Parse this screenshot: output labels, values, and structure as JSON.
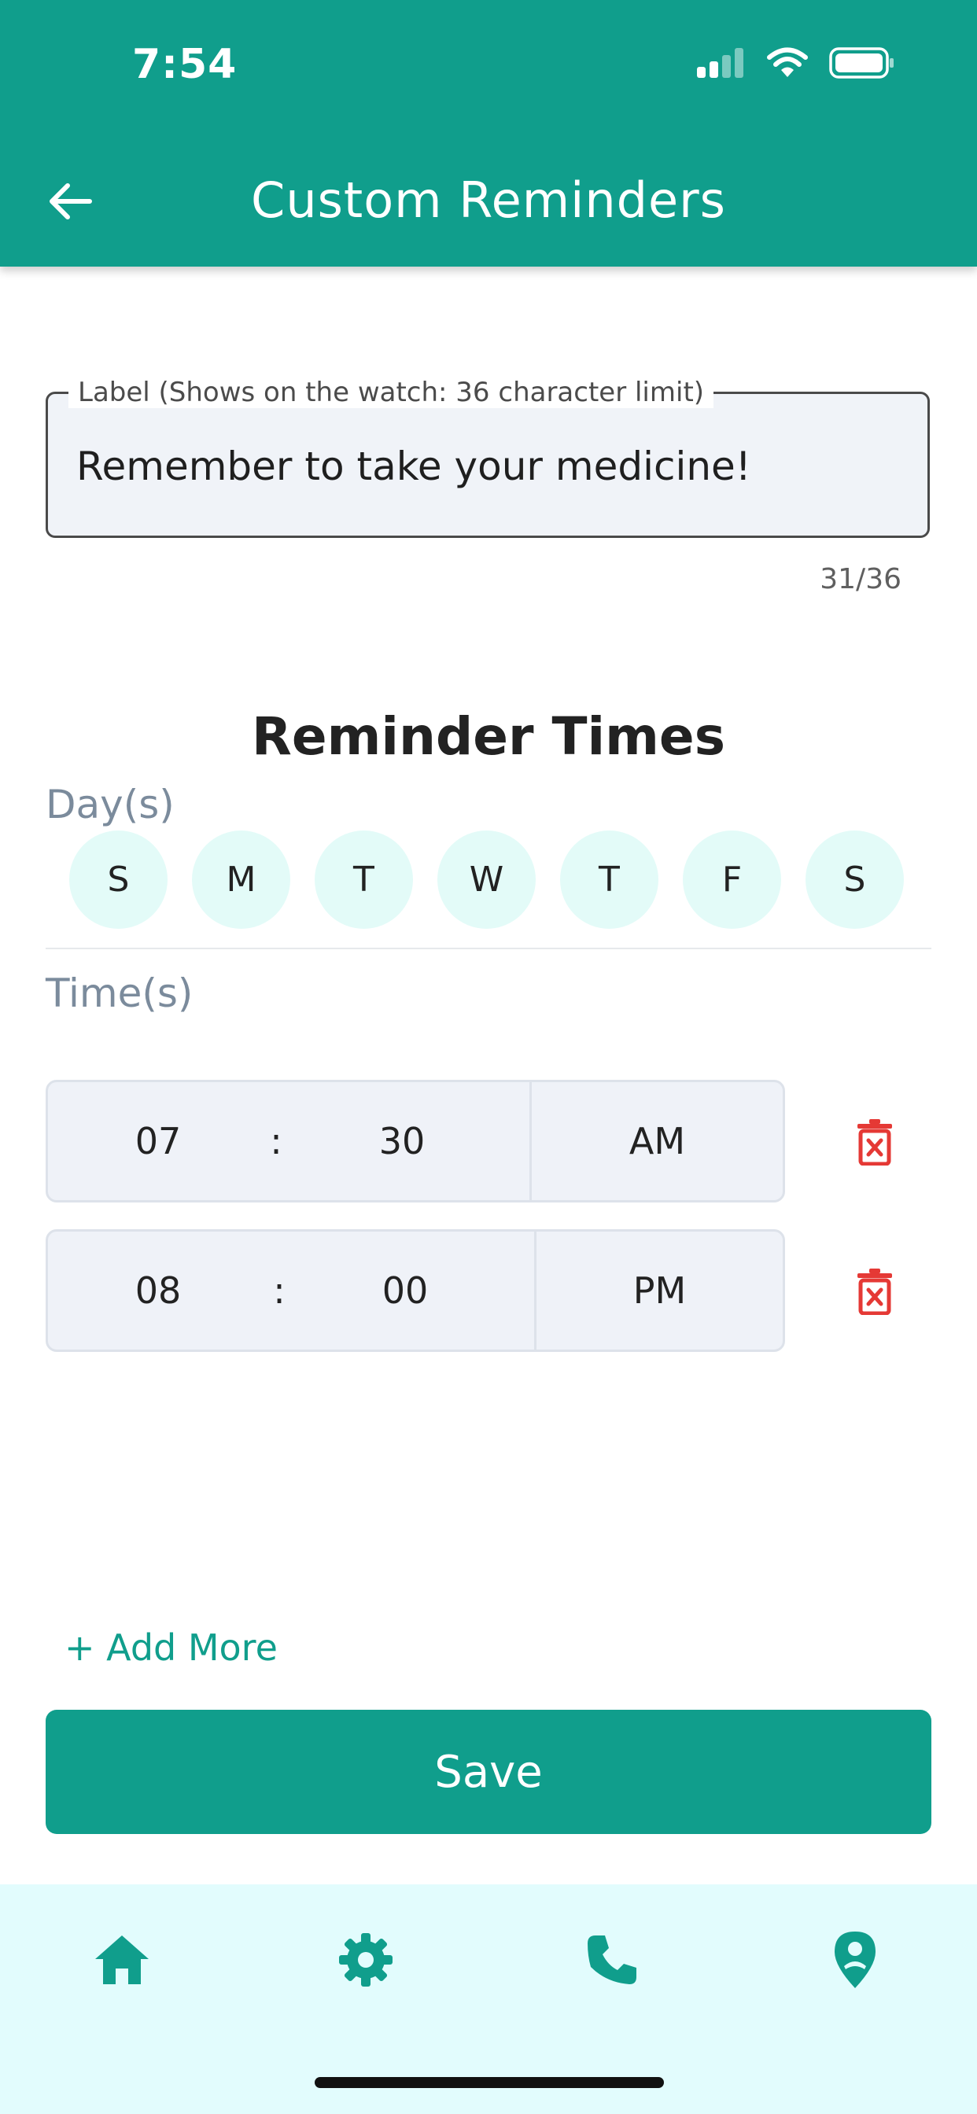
{
  "status_bar": {
    "time": "7:54"
  },
  "header": {
    "title": "Custom Reminders"
  },
  "label_field": {
    "legend": "Label  (Shows on the watch: 36 character limit)",
    "value": "Remember to take your medicine!",
    "counter": "31/36"
  },
  "reminder_times": {
    "title": "Reminder Times",
    "days_label": "Day(s)",
    "days": [
      "S",
      "M",
      "T",
      "W",
      "T",
      "F",
      "S"
    ],
    "times_label": "Time(s)",
    "times": [
      {
        "hour": "07",
        "colon": ":",
        "minute": "30",
        "period": "AM"
      },
      {
        "hour": "08",
        "colon": ":",
        "minute": "00",
        "period": "PM"
      }
    ]
  },
  "actions": {
    "add_more": "+ Add More",
    "save": "Save"
  },
  "bottom_nav": {
    "items": [
      "home-icon",
      "settings-icon",
      "phone-icon",
      "location-icon"
    ]
  },
  "colors": {
    "primary": "#109e8c",
    "day_bg": "#e3fbf8",
    "danger": "#e53935",
    "nav_bg": "#e2fcfd"
  }
}
